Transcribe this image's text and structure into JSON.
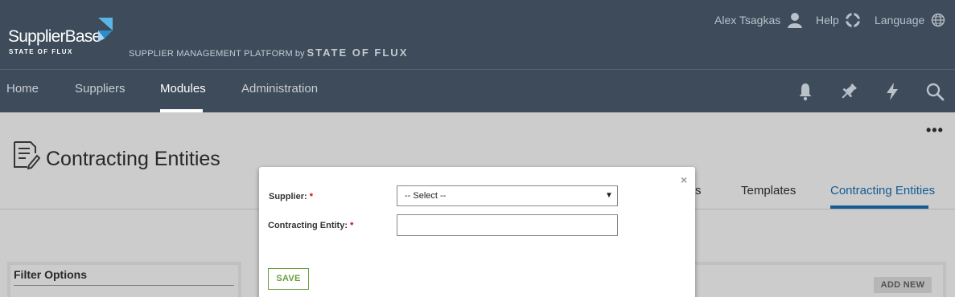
{
  "header": {
    "logo": {
      "brand": "SupplierBase",
      "sub": "STATE OF FLUX"
    },
    "platform": {
      "line": "SUPPLIER MANAGEMENT PLATFORM",
      "by": "by",
      "company": "STATE OF FLUX"
    },
    "user_name": "Alex Tsagkas",
    "help_label": "Help",
    "language_label": "Language",
    "nav": [
      "Home",
      "Suppliers",
      "Modules",
      "Administration"
    ],
    "active_nav": "Modules",
    "icons": [
      "bell-icon",
      "pin-icon",
      "lightning-icon",
      "search-icon"
    ]
  },
  "page": {
    "more_label": "•••",
    "title": "Contracting Entities",
    "tabs": [
      "s",
      "Templates",
      "Contracting Entities"
    ],
    "active_tab": "Contracting Entities",
    "filter_title": "Filter Options",
    "add_new_label": "ADD NEW"
  },
  "modal": {
    "close_label": "×",
    "supplier_label": "Supplier:",
    "supplier_value": "-- Select --",
    "entity_label": "Contracting Entity:",
    "required_mark": "*",
    "entity_value": "",
    "save_label": "SAVE"
  },
  "colors": {
    "header_bg": "#3d4b5a",
    "accent_blue": "#1a73b8",
    "save_green": "#6a9f3f",
    "required_red": "#d0021b"
  }
}
